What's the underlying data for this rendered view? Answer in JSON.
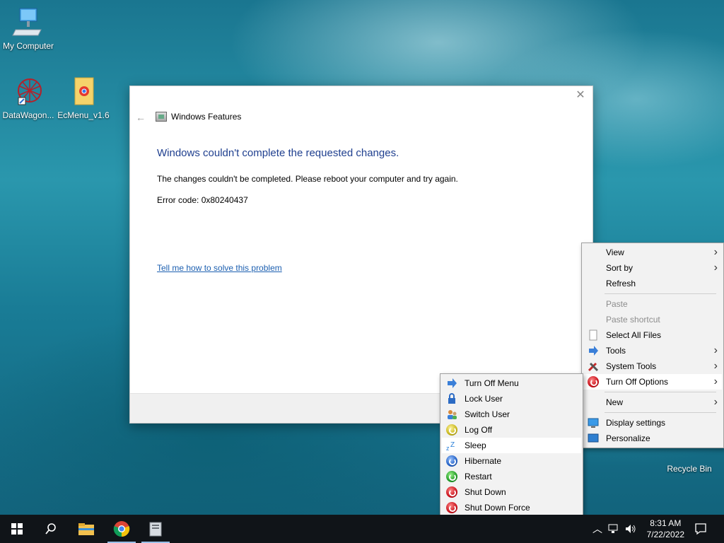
{
  "desktop": {
    "icons": [
      {
        "label": "My Computer"
      },
      {
        "label": "DataWagon..."
      },
      {
        "label": "EcMenu_v1.6"
      },
      {
        "label": "Recycle Bin"
      }
    ]
  },
  "dialog": {
    "title": "Windows Features",
    "heading": "Windows couldn't complete the requested changes.",
    "message": "The changes couldn't be completed. Please reboot your computer and try again.",
    "error_code": "Error code: 0x80240437",
    "help_link": "Tell me how to solve this problem",
    "close_glyph": "✕",
    "back_glyph": "←"
  },
  "context_menu": {
    "items": [
      {
        "label": "View",
        "submenu": true
      },
      {
        "label": "Sort by",
        "submenu": true
      },
      {
        "label": "Refresh"
      },
      {
        "label": "Paste",
        "disabled": true
      },
      {
        "label": "Paste shortcut",
        "disabled": true
      },
      {
        "label": "Select All Files",
        "icon": "file-icon"
      },
      {
        "label": "Tools",
        "icon": "tools-arrow-icon",
        "submenu": true
      },
      {
        "label": "System Tools",
        "icon": "system-tools-icon",
        "submenu": true
      },
      {
        "label": "Turn Off Options",
        "icon": "power-icon",
        "submenu": true,
        "highlighted": true
      },
      {
        "label": "New",
        "submenu": true
      },
      {
        "label": "Display settings",
        "icon": "display-icon"
      },
      {
        "label": "Personalize",
        "icon": "personalize-icon"
      }
    ]
  },
  "turnoff_menu": {
    "items": [
      {
        "label": "Turn Off Menu",
        "icon": "arrow-right-icon"
      },
      {
        "label": "Lock User",
        "icon": "lock-icon"
      },
      {
        "label": "Switch User",
        "icon": "switch-user-icon"
      },
      {
        "label": "Log Off",
        "icon": "logoff-icon"
      },
      {
        "label": "Sleep",
        "icon": "sleep-icon",
        "highlighted": true
      },
      {
        "label": "Hibernate",
        "icon": "hibernate-icon"
      },
      {
        "label": "Restart",
        "icon": "restart-icon"
      },
      {
        "label": "Shut Down",
        "icon": "shutdown-icon"
      },
      {
        "label": "Shut Down Force",
        "icon": "shutdown-force-icon"
      }
    ]
  },
  "taskbar": {
    "time": "8:31 AM",
    "date": "7/22/2022",
    "apps": [
      "start-button",
      "search-button",
      "file-explorer",
      "chrome",
      "app"
    ]
  },
  "colors": {
    "heading": "#1f3f8f",
    "link": "#1c5fb0",
    "taskbar": "#101418"
  }
}
